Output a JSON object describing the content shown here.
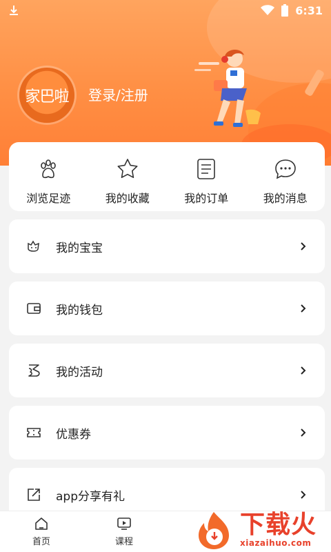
{
  "status_bar": {
    "time": "6:31"
  },
  "header": {
    "avatar_text": "家巴啦",
    "login_label": "登录/注册"
  },
  "quick_actions": [
    {
      "label": "浏览足迹",
      "icon": "paw-icon"
    },
    {
      "label": "我的收藏",
      "icon": "star-icon"
    },
    {
      "label": "我的订单",
      "icon": "order-list-icon"
    },
    {
      "label": "我的消息",
      "icon": "message-bubble-icon"
    }
  ],
  "menu": [
    {
      "label": "我的宝宝",
      "icon": "baby-icon"
    },
    {
      "label": "我的钱包",
      "icon": "wallet-icon"
    },
    {
      "label": "我的活动",
      "icon": "activity-icon"
    },
    {
      "label": "优惠券",
      "icon": "coupon-icon"
    },
    {
      "label": "app分享有礼",
      "icon": "share-icon"
    }
  ],
  "tabs": [
    {
      "label": "首页",
      "icon": "home-icon"
    },
    {
      "label": "课程",
      "icon": "tv-icon"
    }
  ],
  "watermark": {
    "text_cn": "下载火",
    "text_en": "xiazaihuo.com"
  },
  "colors": {
    "header_orange": "#ff8f44",
    "brand_red": "#e8412b"
  }
}
